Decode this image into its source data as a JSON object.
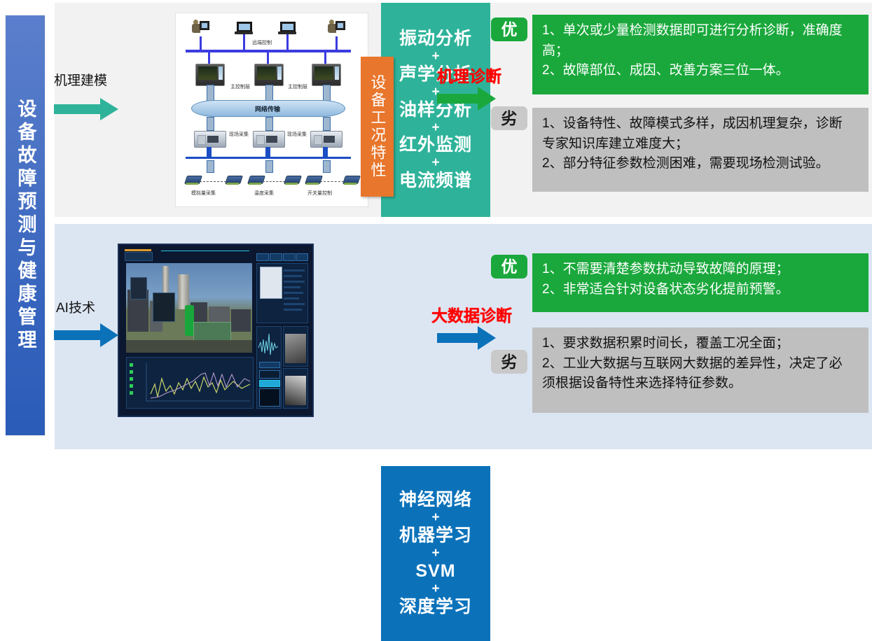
{
  "sidebar": {
    "title": "设备故障预测与健康管理"
  },
  "rows": [
    {
      "input_label": "机理建模",
      "input_arrow_color": "#2eb39a",
      "tag": "设备工况特性",
      "tag_color": "#e8762c",
      "methods_color": "#2eb39a",
      "methods": [
        "振动分析",
        "+",
        "声学分析",
        "+",
        "油样分析",
        "+",
        "红外监测",
        "+",
        "电流频谱"
      ],
      "diagnosis_label": "机理诊断",
      "diagnosis_arrow_color": "#1aa83c",
      "good_badge": "优",
      "bad_badge": "劣",
      "good_text": "1、单次或少量检测数据即可进行分析诊断，准确度高；\n2、故障部位、成因、改善方案三位一体。",
      "good_lines": [
        "1、单次或少量检测数据即可进行分析诊断，准确度",
        "高；",
        "2、故障部位、成因、改善方案三位一体。"
      ],
      "bad_lines": [
        "1、设备特性、故障模式多样，成因机理复杂，诊断",
        "专家知识库建立难度大；",
        "2、部分特征参数检测困难，需要现场检测试验。"
      ],
      "diagram": {
        "labels": [
          "远端控制",
          "主控制层",
          "主控制层",
          "网络传输",
          "现场采集",
          "现场采集",
          "模拟量采集",
          "温度采集",
          "开关量控制"
        ]
      }
    },
    {
      "input_label": "AI技术",
      "input_arrow_color": "#0b72ba",
      "methods_color": "#0b72ba",
      "methods": [
        "神经网络",
        "+",
        "机器学习",
        "+",
        "SVM",
        "+",
        "深度学习"
      ],
      "diagnosis_label": "大数据诊断",
      "diagnosis_arrow_color": "#0b72ba",
      "good_badge": "优",
      "bad_badge": "劣",
      "good_lines": [
        "1、不需要清楚参数扰动导致故障的原理；",
        "2、非常适合针对设备状态劣化提前预警。"
      ],
      "bad_lines": [
        "1、要求数据积累时间长，覆盖工况全面；",
        "2、工业大数据与互联网大数据的差异性，决定了必",
        "须根据设备特性来选择特征参数。"
      ]
    }
  ],
  "colors": {
    "panel_top_bg": "#f2f2f2",
    "panel_bottom_bg": "#dce6f2",
    "good_bg": "#1aa83c",
    "bad_bg": "#bfbfbf",
    "red_label": "#ff0000",
    "sidebar_blue": "#4a72c4"
  }
}
